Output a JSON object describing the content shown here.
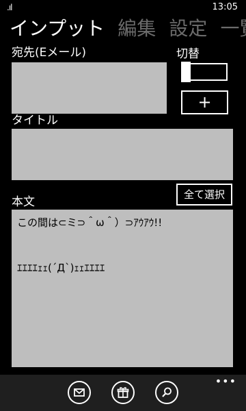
{
  "status": {
    "icons_text": ".ıl",
    "time": "13:05"
  },
  "pivot": {
    "items": [
      {
        "label": "インプット",
        "active": true
      },
      {
        "label": "編集",
        "active": false
      },
      {
        "label": "設定",
        "active": false
      },
      {
        "label": "一覧",
        "active": false
      }
    ]
  },
  "form": {
    "to_label": "宛先(Eメール)",
    "switch_label": "切替",
    "plus_label": "+",
    "title_label": "タイトル",
    "body_label": "本文",
    "select_all_label": "全て選択",
    "body_value": "この間は⊂ミ⊃＾ω＾）⊃ｱｳｱｳ!!\n\n\nｴｴｴｴｪｪ(´Д`)ｪｪｴｴｴｴ"
  },
  "app_bar": {
    "buttons": [
      {
        "icon": "mail-icon"
      },
      {
        "icon": "gift-icon"
      },
      {
        "icon": "search-icon"
      }
    ],
    "more": "•••"
  }
}
